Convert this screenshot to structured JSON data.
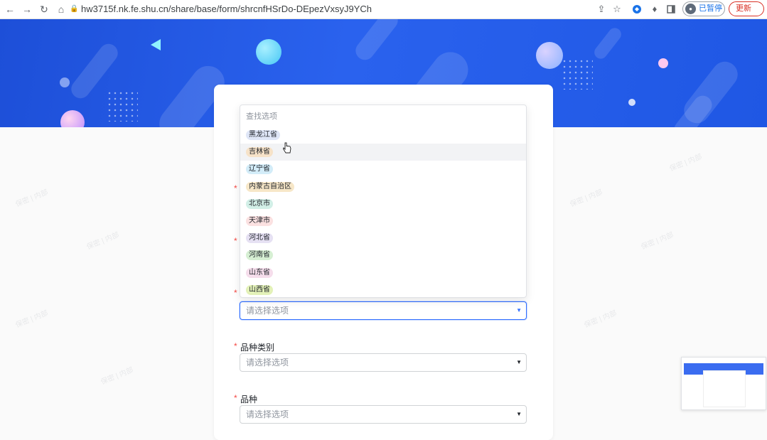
{
  "browser": {
    "back_icon": "arrow-left-icon",
    "forward_icon": "arrow-right-icon",
    "reload_icon": "reload-icon",
    "home_icon": "home-icon",
    "url": "hw3715f.nk.fe.shu.cn/share/base/form/shrcnfHSrDo-DEpezVxsyJ9YCh",
    "profile_label": "已暂停",
    "update_label": "更新"
  },
  "form": {
    "search_placeholder": "查找选项",
    "options": [
      {
        "label": "黑龙江省",
        "color": "#dfe6f7"
      },
      {
        "label": "吉林省",
        "color": "#f6e2c8"
      },
      {
        "label": "辽宁省",
        "color": "#d3ecf8"
      },
      {
        "label": "内蒙古自治区",
        "color": "#f7e7c8"
      },
      {
        "label": "北京市",
        "color": "#d2efe7"
      },
      {
        "label": "天津市",
        "color": "#fbe1e1"
      },
      {
        "label": "河北省",
        "color": "#e6e1f3"
      },
      {
        "label": "河南省",
        "color": "#d6efd3"
      },
      {
        "label": "山东省",
        "color": "#f5ddeb"
      },
      {
        "label": "山西省",
        "color": "#e3f1b8"
      }
    ],
    "select_placeholder": "请选择选项",
    "variety_category_label": "品种类别",
    "variety_label": "品种",
    "required_mark": "*",
    "watermark_text": "保密 | 内部"
  },
  "colors": {
    "banner": "#2a62ee",
    "accent": "#3370ff",
    "required": "#f54a45"
  }
}
